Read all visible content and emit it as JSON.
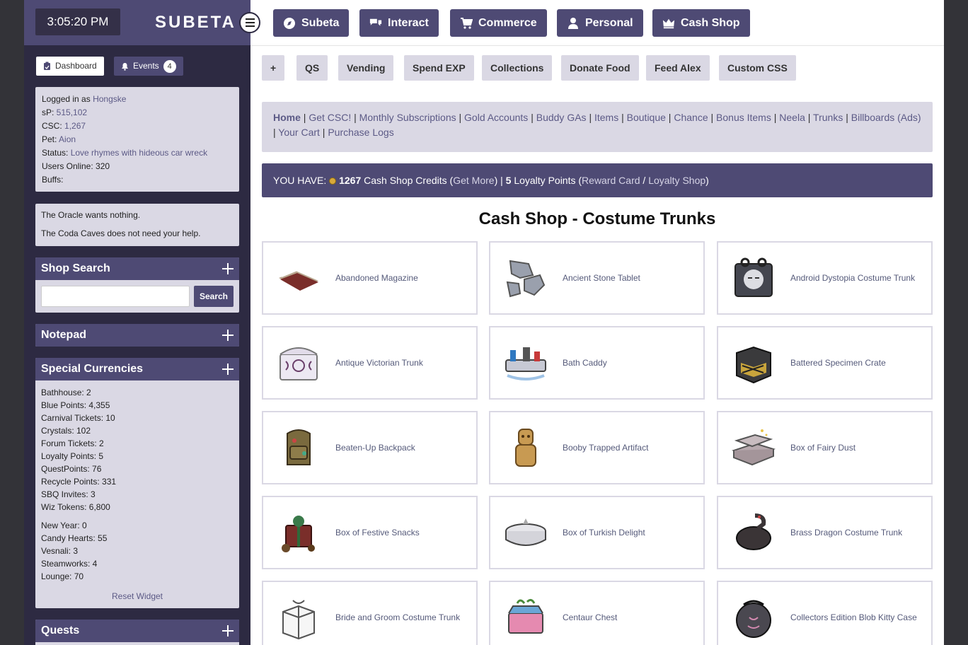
{
  "clock": "3:05:20 PM",
  "logo": "SUBETA",
  "top_nav": [
    {
      "label": "Subeta",
      "icon": "compass-icon"
    },
    {
      "label": "Interact",
      "icon": "chat-icon"
    },
    {
      "label": "Commerce",
      "icon": "cart-icon"
    },
    {
      "label": "Personal",
      "icon": "user-icon"
    },
    {
      "label": "Cash Shop",
      "icon": "crown-icon"
    }
  ],
  "sub_nav": [
    "+",
    "QS",
    "Vending",
    "Spend EXP",
    "Collections",
    "Donate Food",
    "Feed Alex",
    "Custom CSS"
  ],
  "dashboard_label": "Dashboard",
  "events_label": "Events",
  "events_count": "4",
  "user_info": {
    "logged_in_prefix": "Logged in as ",
    "username": "Hongske",
    "sp_label": "sP: ",
    "sp_value": "515,102",
    "csc_label": "CSC: ",
    "csc_value": "1,267",
    "pet_label": "Pet: ",
    "pet_value": "Aion",
    "status_label": "Status: ",
    "status_value": "Love rhymes with hideous car wreck",
    "users_online": "Users Online: 320",
    "buffs": "Buffs:"
  },
  "notices": [
    "The Oracle wants nothing.",
    "The Coda Caves does not need your help."
  ],
  "shop_search": {
    "title": "Shop Search",
    "button": "Search",
    "placeholder": ""
  },
  "notepad_title": "Notepad",
  "special_currencies": {
    "title": "Special Currencies",
    "group1": [
      "Bathhouse: 2",
      "Blue Points: 4,355",
      "Carnival Tickets: 10",
      "Crystals: 102",
      "Forum Tickets: 2",
      "Loyalty Points: 5",
      "QuestPoints: 76",
      "Recycle Points: 331",
      "SBQ Invites: 3",
      "Wiz Tokens: 6,800"
    ],
    "group2": [
      "New Year: 0",
      "Candy Hearts: 55",
      "Vesnali: 3",
      "Steamworks: 4",
      "Lounge: 70"
    ],
    "reset": "Reset Widget"
  },
  "quests_title": "Quests",
  "links": {
    "home": "Home",
    "items": [
      "Get CSC!",
      "Monthly Subscriptions",
      "Gold Accounts",
      "Buddy GAs",
      "Items",
      "Boutique",
      "Chance",
      "Bonus Items",
      "Neela",
      "Trunks",
      "Billboards (Ads)"
    ],
    "items2": [
      "Your Cart",
      "Purchase Logs"
    ]
  },
  "you_have": {
    "prefix": "YOU HAVE: ",
    "credits": "1267",
    "credits_label": " Cash Shop Credits (",
    "get_more": "Get More",
    "mid": ") | ",
    "loyalty": "5",
    "loyalty_label": " Loyalty Points (",
    "reward_card": "Reward Card",
    "slash": " / ",
    "loyalty_shop": "Loyalty Shop",
    "end": ")"
  },
  "page_title": "Cash Shop - Costume Trunks",
  "items": [
    {
      "name": "Abandoned Magazine",
      "icon": "magazine-icon"
    },
    {
      "name": "Ancient Stone Tablet",
      "icon": "stone-tablet-icon"
    },
    {
      "name": "Android Dystopia Costume Trunk",
      "icon": "android-trunk-icon"
    },
    {
      "name": "Antique Victorian Trunk",
      "icon": "victorian-trunk-icon"
    },
    {
      "name": "Bath Caddy",
      "icon": "bath-caddy-icon"
    },
    {
      "name": "Battered Specimen Crate",
      "icon": "specimen-crate-icon"
    },
    {
      "name": "Beaten-Up Backpack",
      "icon": "backpack-icon"
    },
    {
      "name": "Booby Trapped Artifact",
      "icon": "idol-artifact-icon"
    },
    {
      "name": "Box of Fairy Dust",
      "icon": "fairy-dust-box-icon"
    },
    {
      "name": "Box of Festive Snacks",
      "icon": "festive-snacks-icon"
    },
    {
      "name": "Box of Turkish Delight",
      "icon": "turkish-delight-icon"
    },
    {
      "name": "Brass Dragon Costume Trunk",
      "icon": "dragon-trunk-icon"
    },
    {
      "name": "Bride and Groom Costume Trunk",
      "icon": "wedding-trunk-icon"
    },
    {
      "name": "Centaur Chest",
      "icon": "centaur-chest-icon"
    },
    {
      "name": "Collectors Edition Blob Kitty Case",
      "icon": "blob-kitty-case-icon"
    }
  ],
  "colors": {
    "accent": "#4e4a74",
    "panel": "#dad8e4",
    "sidebar": "#2d2a42",
    "link": "#5c5a86"
  }
}
